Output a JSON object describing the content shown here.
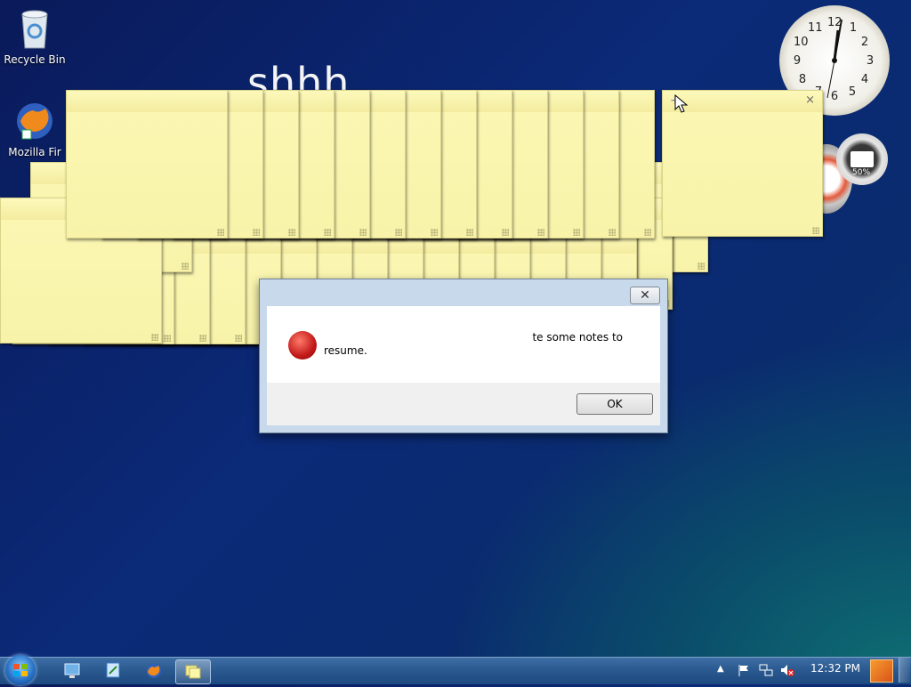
{
  "desktop": {
    "icons": [
      {
        "label": "Recycle Bin",
        "icon": "recycle-bin-icon"
      },
      {
        "label": "Mozilla Fir",
        "icon": "firefox-icon"
      }
    ],
    "background_text": "shhh"
  },
  "clock_gadget": {
    "numbers": [
      "12",
      "1",
      "2",
      "3",
      "4",
      "5",
      "6",
      "7",
      "8",
      "9",
      "10",
      "11"
    ]
  },
  "cpu_gadget": {
    "percent_label": "50%"
  },
  "dialog": {
    "message_line1": "te some notes to",
    "message_line2": "resume.",
    "ok_label": "OK",
    "close_glyph": "✕"
  },
  "note_close_glyph": "×",
  "note_new_glyph": "+",
  "taskbar": {
    "time": "12:32 PM",
    "pinned": [
      "remote-desktop-icon",
      "ie-icon",
      "firefox-icon",
      "sticky-notes-icon"
    ]
  },
  "colors": {
    "note": "#f8f3a9",
    "taskbar": "#2b5a90",
    "desktop": "#0b2a78"
  }
}
